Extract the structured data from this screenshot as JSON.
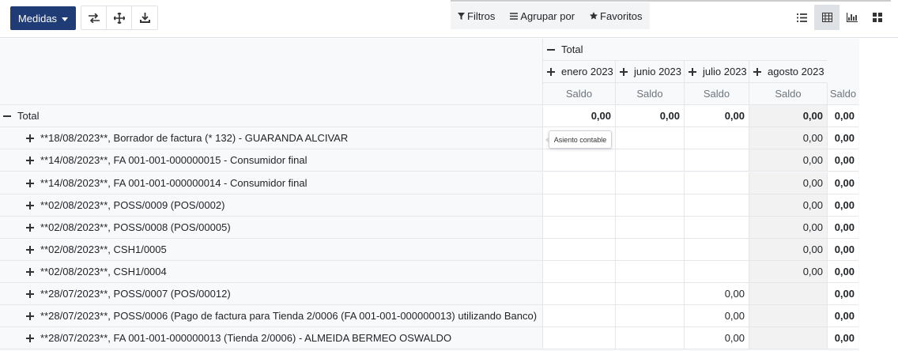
{
  "toolbar": {
    "measures_label": "Medidas",
    "flip_icon": "swap-arrows-icon",
    "expand_icon": "move-arrows-icon",
    "download_icon": "download-icon"
  },
  "search": {
    "filters_label": "Filtros",
    "groupby_label": "Agrupar por",
    "favorites_label": "Favoritos"
  },
  "views": [
    "list-view-icon",
    "pivot-view-icon",
    "graph-view-icon",
    "kanban-view-icon"
  ],
  "pivot": {
    "header_total": "Total",
    "columns": [
      "enero 2023",
      "junio 2023",
      "julio 2023",
      "agosto 2023"
    ],
    "measure": "Saldo",
    "total_row_label": "Total",
    "total_values": [
      "0,00",
      "0,00",
      "0,00",
      "0,00",
      "0,00"
    ],
    "rows": [
      {
        "label": "**18/08/2023**, Borrador de factura (* 132) - GUARANDA ALCIVAR",
        "values": [
          "",
          "",
          "",
          "0,00",
          "0,00"
        ]
      },
      {
        "label": "**14/08/2023**, FA 001-001-000000015 - Consumidor final",
        "values": [
          "",
          "",
          "",
          "0,00",
          "0,00"
        ]
      },
      {
        "label": "**14/08/2023**, FA 001-001-000000014 - Consumidor final",
        "values": [
          "",
          "",
          "",
          "0,00",
          "0,00"
        ]
      },
      {
        "label": "**02/08/2023**, POSS/0009 (POS/0002)",
        "values": [
          "",
          "",
          "",
          "0,00",
          "0,00"
        ]
      },
      {
        "label": "**02/08/2023**, POSS/0008 (POS/00005)",
        "values": [
          "",
          "",
          "",
          "0,00",
          "0,00"
        ]
      },
      {
        "label": "**02/08/2023**, CSH1/0005",
        "values": [
          "",
          "",
          "",
          "0,00",
          "0,00"
        ]
      },
      {
        "label": "**02/08/2023**, CSH1/0004",
        "values": [
          "",
          "",
          "",
          "0,00",
          "0,00"
        ]
      },
      {
        "label": "**28/07/2023**, POSS/0007 (POS/00012)",
        "values": [
          "",
          "",
          "0,00",
          "",
          "0,00"
        ]
      },
      {
        "label": "**28/07/2023**, POSS/0006 (Pago de factura para Tienda 2/0006 (FA 001-001-000000013) utilizando Banco)",
        "values": [
          "",
          "",
          "0,00",
          "",
          "0,00"
        ]
      },
      {
        "label": "**28/07/2023**, FA 001-001-000000013 (Tienda 2/0006) - ALMEIDA BERMEO OSWALDO",
        "values": [
          "",
          "",
          "0,00",
          "",
          "0,00"
        ]
      }
    ]
  },
  "tooltip": {
    "text": "Asiento contable"
  }
}
